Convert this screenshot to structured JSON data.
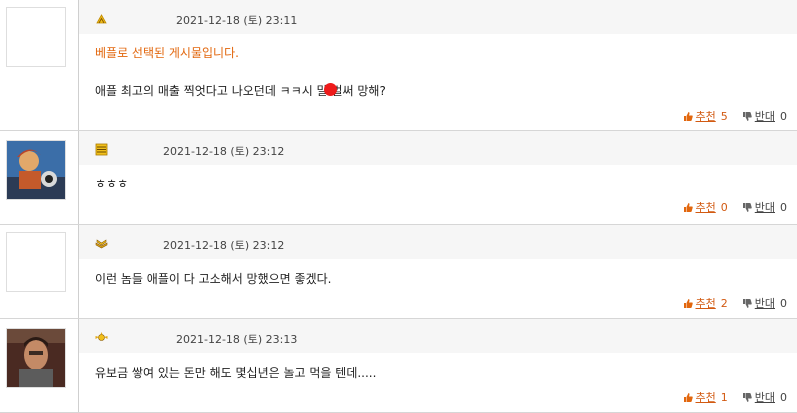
{
  "comments": [
    {
      "date": "2021-12-18 (토) 23:11",
      "best_label": "베플로 선택된 게시물입니다.",
      "text": "애플 최고의 매출 찍엇다고 나오던데 ㅋㅋ시 말 벌써 망해?",
      "up_label": "추천",
      "up_count": "5",
      "down_label": "반대",
      "down_count": "0",
      "level_icon": "double-chevron-badge-icon",
      "avatar": "empty"
    },
    {
      "date": "2021-12-18 (토) 23:12",
      "text": "ㅎㅎㅎ",
      "up_label": "추천",
      "up_count": "0",
      "down_label": "반대",
      "down_count": "0",
      "level_icon": "stacked-bars-badge-icon",
      "avatar": "cartoon-character-photo"
    },
    {
      "date": "2021-12-18 (토) 23:12",
      "text": "이런 놈들 애플이 다 고소해서 망했으면 좋겠다.",
      "up_label": "추천",
      "up_count": "2",
      "down_label": "반대",
      "down_count": "0",
      "level_icon": "folded-wings-badge-icon",
      "avatar": "empty"
    },
    {
      "date": "2021-12-18 (토) 23:13",
      "text": "유보금 쌓여 있는 돈만 해도 몇십년은 놀고 먹을 텐데.....",
      "up_label": "추천",
      "up_count": "1",
      "down_label": "반대",
      "down_count": "0",
      "level_icon": "winged-badge-icon",
      "avatar": "man-photo"
    }
  ],
  "colors": {
    "best": "#e2670e",
    "up": "#d25a12",
    "meta_bg": "#f6f6f6",
    "divider": "#d6d6d6"
  }
}
